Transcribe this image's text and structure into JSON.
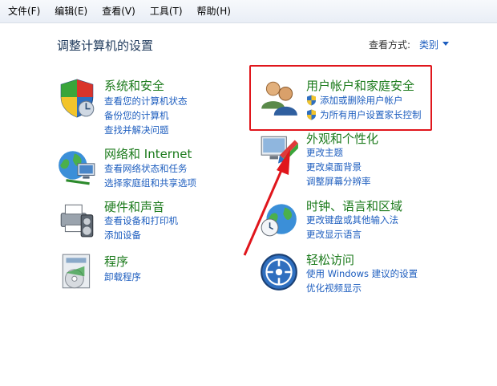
{
  "menu": [
    "文件(F)",
    "编辑(E)",
    "查看(V)",
    "工具(T)",
    "帮助(H)"
  ],
  "header": {
    "title": "调整计算机的设置",
    "view_label": "查看方式:",
    "view_value": "类别"
  },
  "categories": {
    "system": {
      "title": "系统和安全",
      "links": [
        "查看您的计算机状态",
        "备份您的计算机",
        "查找并解决问题"
      ]
    },
    "network": {
      "title": "网络和 Internet",
      "links": [
        "查看网络状态和任务",
        "选择家庭组和共享选项"
      ]
    },
    "hardware": {
      "title": "硬件和声音",
      "links": [
        "查看设备和打印机",
        "添加设备"
      ]
    },
    "programs": {
      "title": "程序",
      "links": [
        "卸载程序"
      ]
    },
    "users": {
      "title": "用户帐户和家庭安全",
      "links": [
        "添加或删除用户帐户",
        "为所有用户设置家长控制"
      ]
    },
    "appearance": {
      "title": "外观和个性化",
      "links": [
        "更改主题",
        "更改桌面背景",
        "调整屏幕分辨率"
      ]
    },
    "clock": {
      "title": "时钟、语言和区域",
      "links": [
        "更改键盘或其他输入法",
        "更改显示语言"
      ]
    },
    "ease": {
      "title": "轻松访问",
      "links": [
        "使用 Windows 建议的设置",
        "优化视频显示"
      ]
    }
  },
  "colors": {
    "title_green": "#1b7a1b",
    "link_blue": "#1e5ebf",
    "annotation_red": "#e0161c"
  }
}
